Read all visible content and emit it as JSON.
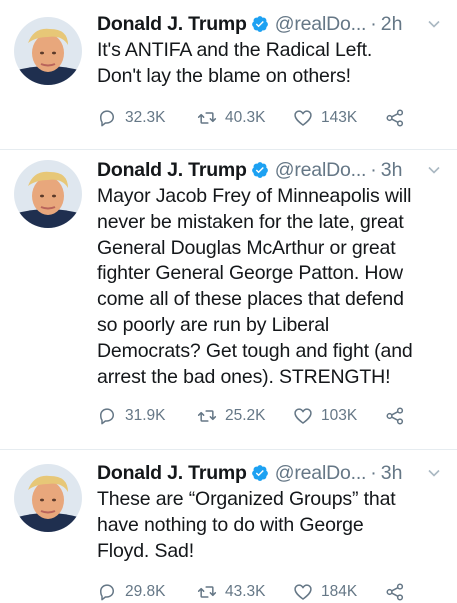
{
  "tweets": [
    {
      "name": "Donald J. Trump",
      "handle": "@realDo...",
      "dot": "·",
      "time": "2h",
      "text": "It's ANTIFA and the Radical Left.\nDon't lay the blame on others!",
      "replies": "32.3K",
      "retweets": "40.3K",
      "likes": "143K"
    },
    {
      "name": "Donald J. Trump",
      "handle": "@realDo...",
      "dot": "·",
      "time": "3h",
      "text": "Mayor Jacob Frey of Minneapolis will\nnever be mistaken for the late, great\nGeneral Douglas McArthur or great\nfighter General George Patton. How\ncome all of these places that defend\nso poorly are run by Liberal\nDemocrats? Get tough and fight (and\narrest the bad ones). STRENGTH!",
      "replies": "31.9K",
      "retweets": "25.2K",
      "likes": "103K"
    },
    {
      "name": "Donald J. Trump",
      "handle": "@realDo...",
      "dot": "·",
      "time": "3h",
      "text": "These are “Organized Groups” that\nhave nothing to do with George\nFloyd. Sad!",
      "replies": "29.8K",
      "retweets": "43.3K",
      "likes": "184K"
    }
  ],
  "icons": {
    "avatar": "profile-photo",
    "verified": "verified-badge-icon",
    "chevron": "chevron-down-icon",
    "reply": "reply-icon",
    "retweet": "retweet-icon",
    "like": "heart-icon",
    "share": "share-icon"
  },
  "colors": {
    "text": "#14171a",
    "secondary": "#657786",
    "verified": "#1da1f2",
    "divider": "#e6ecf0"
  }
}
